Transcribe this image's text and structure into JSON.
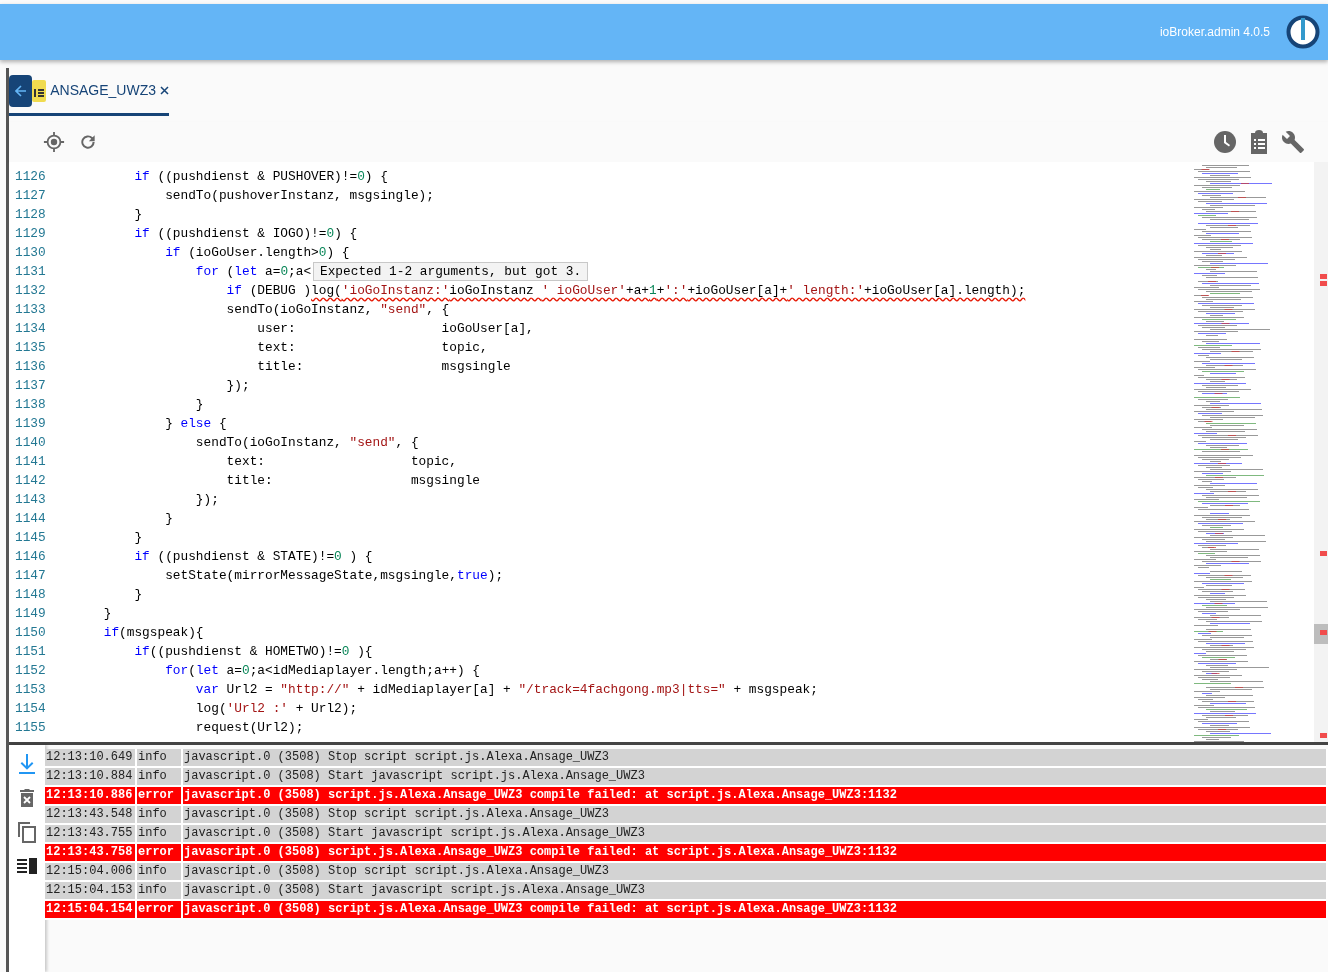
{
  "header": {
    "version": "ioBroker.admin 4.0.5"
  },
  "tabs": [
    {
      "label": "ANSAGE_UWZ3",
      "selected": true
    }
  ],
  "editor": {
    "lines": [
      {
        "number": "1126",
        "tokens": [
          {
            "kind": "keyword",
            "text": "        if"
          },
          {
            "kind": "plain",
            "text": " ((pushdienst & PUSHOVER)!="
          },
          {
            "kind": "number",
            "text": "0"
          },
          {
            "kind": "plain",
            "text": ") {"
          }
        ]
      },
      {
        "number": "1127",
        "tokens": [
          {
            "kind": "plain",
            "text": "            sendTo(pushoverInstanz, msgsingle);"
          }
        ]
      },
      {
        "number": "1128",
        "tokens": [
          {
            "kind": "plain",
            "text": "        }"
          }
        ]
      },
      {
        "number": "1129",
        "tokens": [
          {
            "kind": "keyword",
            "text": "        if"
          },
          {
            "kind": "plain",
            "text": " ((pushdienst & IOGO)!="
          },
          {
            "kind": "number",
            "text": "0"
          },
          {
            "kind": "plain",
            "text": ") {"
          }
        ]
      },
      {
        "number": "1130",
        "tokens": [
          {
            "kind": "keyword",
            "text": "            if"
          },
          {
            "kind": "plain",
            "text": " (ioGoUser.length>"
          },
          {
            "kind": "number",
            "text": "0"
          },
          {
            "kind": "plain",
            "text": ") {"
          }
        ]
      },
      {
        "number": "1131",
        "tokens": [
          {
            "kind": "keyword",
            "text": "                for"
          },
          {
            "kind": "plain",
            "text": " ("
          },
          {
            "kind": "keyword",
            "text": "let"
          },
          {
            "kind": "plain",
            "text": " a="
          },
          {
            "kind": "number",
            "text": "0"
          },
          {
            "kind": "plain",
            "text": ";a<"
          }
        ],
        "tooltip": "Expected 1-2 arguments, but got 3."
      },
      {
        "number": "1132",
        "tokens": [
          {
            "kind": "keyword",
            "text": "                    if"
          },
          {
            "kind": "plain",
            "text": " (DEBUG )"
          }
        ],
        "error_tokens": [
          {
            "kind": "plain",
            "text": "log("
          },
          {
            "kind": "string",
            "text": "'ioGoInstanz:'"
          },
          {
            "kind": "plain",
            "text": "ioGoInstanz "
          },
          {
            "kind": "string",
            "text": "' ioGoUser'"
          },
          {
            "kind": "plain",
            "text": "+a+"
          },
          {
            "kind": "number",
            "text": "1"
          },
          {
            "kind": "plain",
            "text": "+"
          },
          {
            "kind": "string",
            "text": "':'"
          },
          {
            "kind": "plain",
            "text": "+ioGoUser[a]+"
          },
          {
            "kind": "string",
            "text": "' length:'"
          },
          {
            "kind": "plain",
            "text": "+ioGoUser[a].length);"
          }
        ]
      },
      {
        "number": "1133",
        "tokens": [
          {
            "kind": "plain",
            "text": "                    sendTo(ioGoInstanz, "
          },
          {
            "kind": "string",
            "text": "\"send\""
          },
          {
            "kind": "plain",
            "text": ", {"
          }
        ]
      },
      {
        "number": "1134",
        "tokens": [
          {
            "kind": "plain",
            "text": "                        user:                   ioGoUser[a],"
          }
        ]
      },
      {
        "number": "1135",
        "tokens": [
          {
            "kind": "plain",
            "text": "                        text:                   topic,"
          }
        ]
      },
      {
        "number": "1136",
        "tokens": [
          {
            "kind": "plain",
            "text": "                        title:                  msgsingle"
          }
        ]
      },
      {
        "number": "1137",
        "tokens": [
          {
            "kind": "plain",
            "text": "                    });"
          }
        ]
      },
      {
        "number": "1138",
        "tokens": [
          {
            "kind": "plain",
            "text": "                }"
          }
        ]
      },
      {
        "number": "1139",
        "tokens": [
          {
            "kind": "plain",
            "text": "            } "
          },
          {
            "kind": "keyword",
            "text": "else"
          },
          {
            "kind": "plain",
            "text": " {"
          }
        ]
      },
      {
        "number": "1140",
        "tokens": [
          {
            "kind": "plain",
            "text": "                sendTo(ioGoInstanz, "
          },
          {
            "kind": "string",
            "text": "\"send\""
          },
          {
            "kind": "plain",
            "text": ", {"
          }
        ]
      },
      {
        "number": "1141",
        "tokens": [
          {
            "kind": "plain",
            "text": "                    text:                   topic,"
          }
        ]
      },
      {
        "number": "1142",
        "tokens": [
          {
            "kind": "plain",
            "text": "                    title:                  msgsingle"
          }
        ]
      },
      {
        "number": "1143",
        "tokens": [
          {
            "kind": "plain",
            "text": "                });"
          }
        ]
      },
      {
        "number": "1144",
        "tokens": [
          {
            "kind": "plain",
            "text": "            }"
          }
        ]
      },
      {
        "number": "1145",
        "tokens": [
          {
            "kind": "plain",
            "text": "        }"
          }
        ]
      },
      {
        "number": "1146",
        "tokens": [
          {
            "kind": "keyword",
            "text": "        if"
          },
          {
            "kind": "plain",
            "text": " ((pushdienst & STATE)!="
          },
          {
            "kind": "number",
            "text": "0"
          },
          {
            "kind": "plain",
            "text": " ) {"
          }
        ]
      },
      {
        "number": "1147",
        "tokens": [
          {
            "kind": "plain",
            "text": "            setState(mirrorMessageState,msgsingle,"
          },
          {
            "kind": "keyword",
            "text": "true"
          },
          {
            "kind": "plain",
            "text": ");"
          }
        ]
      },
      {
        "number": "1148",
        "tokens": [
          {
            "kind": "plain",
            "text": "        }"
          }
        ]
      },
      {
        "number": "1149",
        "tokens": [
          {
            "kind": "plain",
            "text": "    }"
          }
        ]
      },
      {
        "number": "1150",
        "tokens": [
          {
            "kind": "keyword",
            "text": "    if"
          },
          {
            "kind": "plain",
            "text": "(msgspeak){"
          }
        ]
      },
      {
        "number": "1151",
        "tokens": [
          {
            "kind": "keyword",
            "text": "        if"
          },
          {
            "kind": "plain",
            "text": "((pushdienst & HOMETWO)!="
          },
          {
            "kind": "number",
            "text": "0"
          },
          {
            "kind": "plain",
            "text": " ){"
          }
        ]
      },
      {
        "number": "1152",
        "tokens": [
          {
            "kind": "keyword",
            "text": "            for"
          },
          {
            "kind": "plain",
            "text": "("
          },
          {
            "kind": "keyword",
            "text": "let"
          },
          {
            "kind": "plain",
            "text": " a="
          },
          {
            "kind": "number",
            "text": "0"
          },
          {
            "kind": "plain",
            "text": ";a<idMediaplayer.length;a++) {"
          }
        ]
      },
      {
        "number": "1153",
        "tokens": [
          {
            "kind": "keyword",
            "text": "                var"
          },
          {
            "kind": "plain",
            "text": " Url2 = "
          },
          {
            "kind": "string",
            "text": "\"http://\""
          },
          {
            "kind": "plain",
            "text": " + idMediaplayer[a] + "
          },
          {
            "kind": "string",
            "text": "\"/track=4fachgong.mp3|tts=\""
          },
          {
            "kind": "plain",
            "text": " + msgspeak;"
          }
        ]
      },
      {
        "number": "1154",
        "tokens": [
          {
            "kind": "plain",
            "text": "                log("
          },
          {
            "kind": "string",
            "text": "'Url2 :'"
          },
          {
            "kind": "plain",
            "text": " + Url2);"
          }
        ]
      },
      {
        "number": "1155",
        "tokens": [
          {
            "kind": "plain",
            "text": "                request(Url2);"
          }
        ]
      }
    ]
  },
  "log": [
    {
      "time": "12:13:10.649",
      "severity": "info",
      "message": "javascript.0 (3508) Stop script script.js.Alexa.Ansage_UWZ3"
    },
    {
      "time": "12:13:10.884",
      "severity": "info",
      "message": "javascript.0 (3508) Start javascript script.js.Alexa.Ansage_UWZ3"
    },
    {
      "time": "12:13:10.886",
      "severity": "error",
      "message": "javascript.0 (3508) script.js.Alexa.Ansage_UWZ3 compile failed: at script.js.Alexa.Ansage_UWZ3:1132"
    },
    {
      "time": "12:13:43.548",
      "severity": "info",
      "message": "javascript.0 (3508) Stop script script.js.Alexa.Ansage_UWZ3"
    },
    {
      "time": "12:13:43.755",
      "severity": "info",
      "message": "javascript.0 (3508) Start javascript script.js.Alexa.Ansage_UWZ3"
    },
    {
      "time": "12:13:43.758",
      "severity": "error",
      "message": "javascript.0 (3508) script.js.Alexa.Ansage_UWZ3 compile failed: at script.js.Alexa.Ansage_UWZ3:1132"
    },
    {
      "time": "12:15:04.006",
      "severity": "info",
      "message": "javascript.0 (3508) Stop script script.js.Alexa.Ansage_UWZ3"
    },
    {
      "time": "12:15:04.153",
      "severity": "info",
      "message": "javascript.0 (3508) Start javascript script.js.Alexa.Ansage_UWZ3"
    },
    {
      "time": "12:15:04.154",
      "severity": "error",
      "message": "javascript.0 (3508) script.js.Alexa.Ansage_UWZ3 compile failed: at script.js.Alexa.Ansage_UWZ3:1132"
    }
  ]
}
